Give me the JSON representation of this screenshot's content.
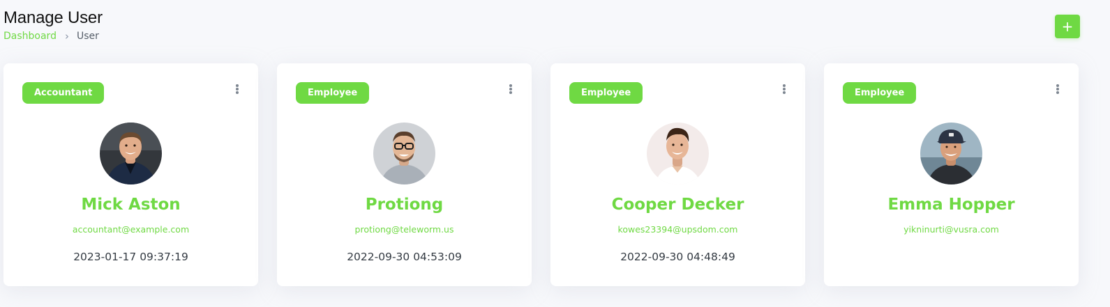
{
  "header": {
    "title": "Manage User",
    "breadcrumb": {
      "dashboard": "Dashboard",
      "separator": "›",
      "current": "User"
    },
    "add_button": "+",
    "add_icon": "plus-icon"
  },
  "colors": {
    "accent": "#6fd943",
    "background": "#f7f8fb",
    "card": "#ffffff"
  },
  "users": [
    {
      "role": "Accountant",
      "name": "Mick Aston",
      "email": "accountant@example.com",
      "date": "2023-01-17 09:37:19"
    },
    {
      "role": "Employee",
      "name": "Protiong",
      "email": "protiong@teleworm.us",
      "date": "2022-09-30 04:53:09"
    },
    {
      "role": "Employee",
      "name": "Cooper Decker",
      "email": "kowes23394@upsdom.com",
      "date": "2022-09-30 04:48:49"
    },
    {
      "role": "Employee",
      "name": "Emma Hopper",
      "email": "yikninurti@vusra.com",
      "date": ""
    }
  ],
  "card_menu_icon": "more-vertical-icon"
}
